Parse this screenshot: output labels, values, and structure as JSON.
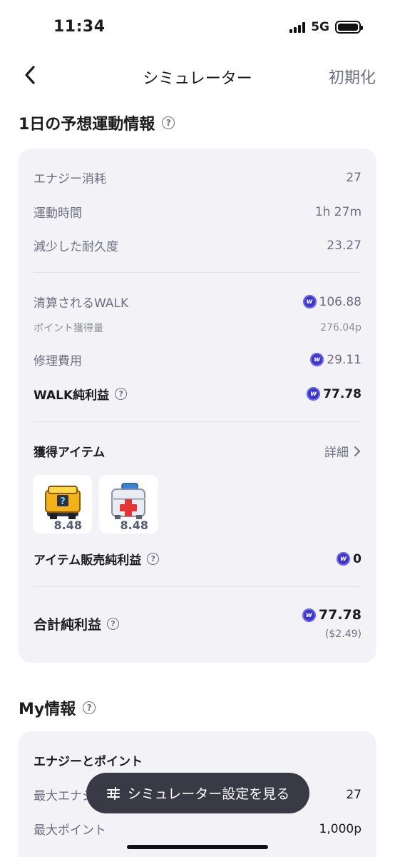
{
  "status": {
    "time": "11:34",
    "network": "5G"
  },
  "nav": {
    "title": "シミュレーター",
    "reset_label": "初期化"
  },
  "daily_section": {
    "title": "1日の予想運動情報",
    "stats": [
      {
        "label": "エナジー消耗",
        "value": "27"
      },
      {
        "label": "運動時間",
        "value": "1h 27m"
      },
      {
        "label": "減少した耐久度",
        "value": "23.27"
      }
    ],
    "walk_settled": {
      "label": "清算されるWALK",
      "value": "106.88"
    },
    "points_earned": {
      "label": "ポイント獲得量",
      "value": "276.04p"
    },
    "repair_cost": {
      "label": "修理費用",
      "value": "29.11"
    },
    "walk_net_profit": {
      "label": "WALK純利益",
      "value": "77.78"
    },
    "items": {
      "label": "獲得アイテム",
      "detail_label": "詳細",
      "list": [
        {
          "icon": "mystery-box-icon",
          "count": "8.48"
        },
        {
          "icon": "repair-kit-icon",
          "count": "8.48"
        }
      ]
    },
    "item_sales_profit": {
      "label": "アイテム販売純利益",
      "value": "0"
    },
    "total_profit": {
      "label": "合計純利益",
      "value": "77.78",
      "usd": "($2.49)"
    }
  },
  "my_info": {
    "title": "My情報",
    "subheading": "エナジーとポイント",
    "max_energy": {
      "label": "最大エナジ",
      "value": "27"
    },
    "max_points": {
      "label": "最大ポイント",
      "value": "1,000p"
    }
  },
  "toast": {
    "label": "シミュレーター設定を見る"
  },
  "colors": {
    "walk_coin": "#3b36c9",
    "card_bg": "#f3f3f7",
    "toast_bg": "#3a3a47"
  }
}
